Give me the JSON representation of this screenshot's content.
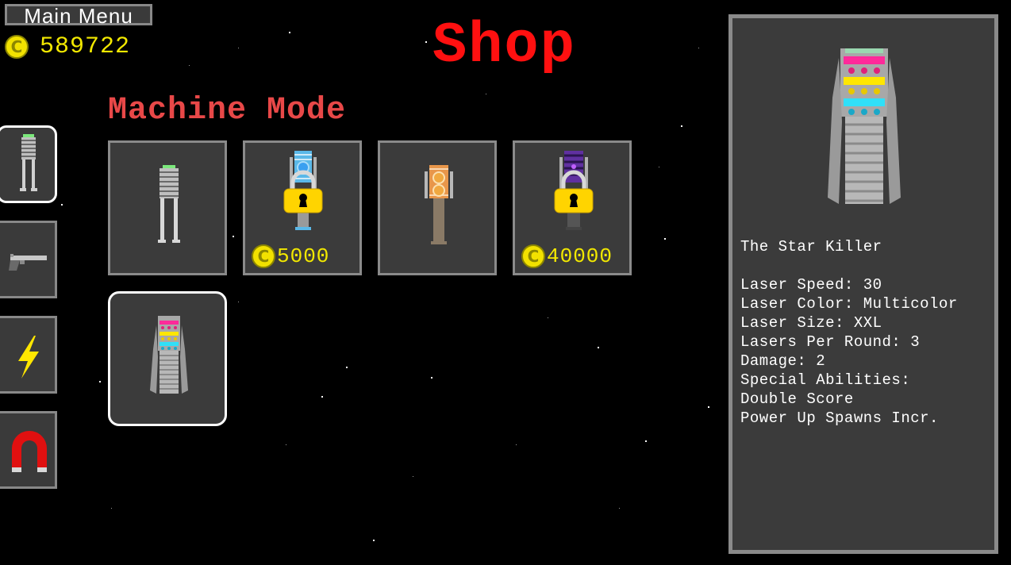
{
  "header": {
    "main_menu_label": "Main Menu",
    "coin_symbol": "C",
    "coin_total": "589722",
    "title": "Shop",
    "mode_title": "Machine Mode"
  },
  "categories": [
    {
      "name": "machine",
      "icon": "machine-icon",
      "selected": true
    },
    {
      "name": "gun",
      "icon": "gun-icon",
      "selected": false
    },
    {
      "name": "power-up",
      "icon": "lightning-icon",
      "selected": false
    },
    {
      "name": "magnet",
      "icon": "magnet-icon",
      "selected": false
    }
  ],
  "items": [
    {
      "id": "basic-machine",
      "locked": false,
      "price": "",
      "selected": false
    },
    {
      "id": "blue-machine",
      "locked": true,
      "price": "5000",
      "selected": false
    },
    {
      "id": "orange-machine",
      "locked": false,
      "price": "",
      "selected": false
    },
    {
      "id": "purple-machine",
      "locked": true,
      "price": "40000",
      "selected": false
    },
    {
      "id": "star-killer-machine",
      "locked": false,
      "price": "",
      "selected": true
    }
  ],
  "detail": {
    "name": "The Star Killer",
    "stats": [
      "Laser Speed: 30",
      "Laser Color: Multicolor",
      "Laser Size: XXL",
      "Lasers Per Round: 3",
      "Damage: 2",
      "Special Abilities:",
      "Double Score",
      "Power Up Spawns Incr."
    ]
  },
  "colors": {
    "background": "#000000",
    "title_red": "#ff1010",
    "mode_title_red": "#e84848",
    "coin_yellow": "#f2e100",
    "panel_gray": "#3b3b3b",
    "border_gray": "#8a8a8a"
  }
}
